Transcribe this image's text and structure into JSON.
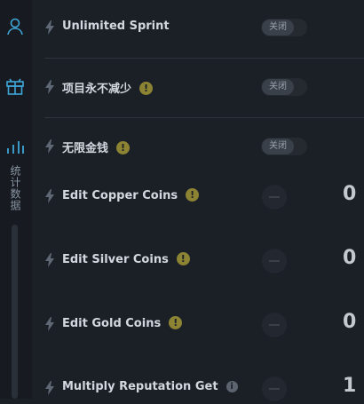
{
  "sidebar": {
    "items": [
      {
        "icon": "user-icon"
      },
      {
        "icon": "gift-box-icon"
      },
      {
        "icon": "bar-chart-icon"
      }
    ],
    "section_label": "统计数据"
  },
  "cheats": [
    {
      "label": "Unlimited Sprint",
      "control": "toggle",
      "value": "关闭"
    },
    {
      "label": "项目永不减少",
      "control": "toggle",
      "value": "关闭",
      "badge": "!"
    },
    {
      "label": "无限金钱",
      "control": "toggle",
      "value": "关闭",
      "badge": "!"
    },
    {
      "label": "Edit Copper Coins",
      "control": "stepper",
      "value": "0",
      "badge": "!"
    },
    {
      "label": "Edit Silver Coins",
      "control": "stepper",
      "value": "0",
      "badge": "!"
    },
    {
      "label": "Edit Gold Coins",
      "control": "stepper",
      "value": "0",
      "badge": "!"
    },
    {
      "label": "Multiply Reputation Get",
      "control": "stepper",
      "value": "1",
      "badge": "i"
    }
  ],
  "colors": {
    "accent": "#3fa6d8",
    "warning": "#8c8333",
    "background": "#1b2027"
  }
}
